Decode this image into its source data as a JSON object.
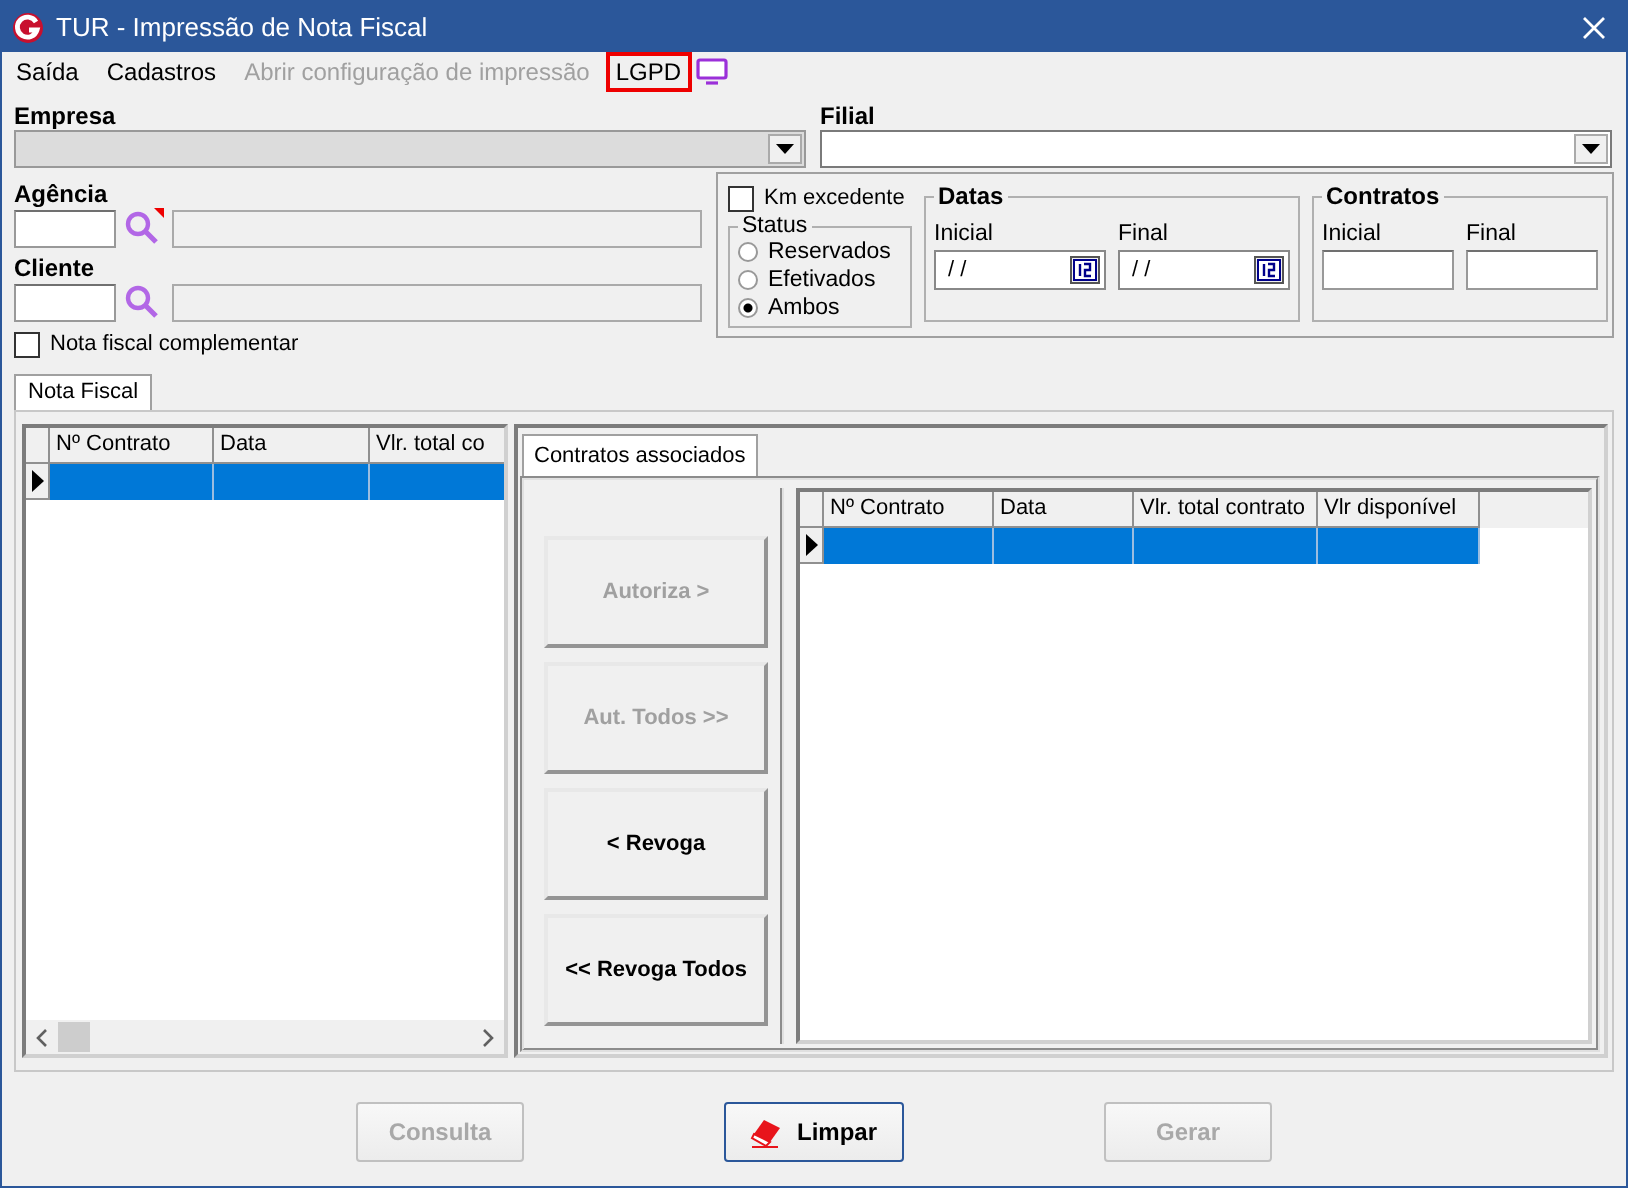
{
  "window": {
    "title": "TUR - Impressão de Nota Fiscal"
  },
  "menu": [
    {
      "label": "Saída",
      "disabled": false,
      "highlighted": false
    },
    {
      "label": "Cadastros",
      "disabled": false,
      "highlighted": false
    },
    {
      "label": "Abrir configuração de impressão",
      "disabled": true,
      "highlighted": false
    },
    {
      "label": "LGPD",
      "disabled": false,
      "highlighted": true
    }
  ],
  "empresa": {
    "label": "Empresa"
  },
  "filial": {
    "label": "Filial"
  },
  "agencia": {
    "label": "Agência"
  },
  "cliente": {
    "label": "Cliente"
  },
  "nota_complementar": {
    "label": "Nota fiscal complementar",
    "checked": false
  },
  "km_excedente": {
    "label": "Km excedente",
    "checked": false
  },
  "status": {
    "label": "Status",
    "options": [
      {
        "label": "Reservados",
        "selected": false
      },
      {
        "label": "Efetivados",
        "selected": false
      },
      {
        "label": "Ambos",
        "selected": true
      }
    ]
  },
  "datas": {
    "label": "Datas",
    "fields": [
      {
        "label": "Inicial",
        "value": "/ /"
      },
      {
        "label": "Final",
        "value": "/ /"
      }
    ]
  },
  "contratos": {
    "label": "Contratos",
    "fields": [
      {
        "label": "Inicial"
      },
      {
        "label": "Final"
      }
    ]
  },
  "tabs": [
    {
      "label": "Nota Fiscal",
      "selected": true
    }
  ],
  "left_grid": {
    "columns": [
      "Nº Contrato",
      "Data",
      "Vlr. total co"
    ],
    "rows": [
      {
        "selected": true
      }
    ]
  },
  "inner_tabs": [
    {
      "label": "Contratos associados",
      "selected": true
    }
  ],
  "actions": [
    {
      "label": "Autoriza >",
      "disabled": true
    },
    {
      "label": "Aut. Todos >>",
      "disabled": true
    },
    {
      "label": "< Revoga",
      "disabled": false
    },
    {
      "label": "<< Revoga Todos",
      "disabled": false
    }
  ],
  "right_grid": {
    "columns": [
      "Nº Contrato",
      "Data",
      "Vlr. total contrato",
      "Vlr disponível"
    ],
    "rows": [
      {
        "selected": true
      }
    ]
  },
  "buttons": [
    {
      "label": "Consulta",
      "disabled": true,
      "kind": "plain"
    },
    {
      "label": "Limpar",
      "disabled": false,
      "kind": "primary"
    },
    {
      "label": "Gerar",
      "disabled": true,
      "kind": "plain"
    }
  ]
}
